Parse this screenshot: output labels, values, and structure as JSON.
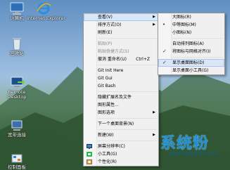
{
  "desktop_icons": [
    {
      "label": "计算机",
      "icon": "computer-icon"
    },
    {
      "label": "Internet Explorer",
      "icon": "ie-icon"
    },
    {
      "label": "回收站",
      "icon": "recycle-bin-icon"
    },
    {
      "label": "Remote Desktop",
      "icon": "remote-desktop-icon"
    },
    {
      "label": "宽带连接",
      "icon": "broadband-icon"
    },
    {
      "label": "控制面板",
      "icon": "control-panel-icon"
    }
  ],
  "context_menu": {
    "items": [
      {
        "label": "查看(V)",
        "submenu": true,
        "highlighted": true
      },
      {
        "label": "排序方式(O)",
        "submenu": true
      },
      {
        "label": "刷新(E)"
      },
      {
        "label": "粘贴(P)",
        "disabled": true
      },
      {
        "label": "粘贴快捷方式(S)",
        "disabled": true
      },
      {
        "label": "撤消 重命名(U)",
        "shortcut": "Ctrl+Z"
      },
      {
        "label": "Git Init Here"
      },
      {
        "label": "Git Gui"
      },
      {
        "label": "Git Bash"
      },
      {
        "label": "隐藏扩展名及文件"
      },
      {
        "label": "图形属性..."
      },
      {
        "label": "图形选项",
        "submenu": true
      },
      {
        "label": "下一个桌面背景(N)"
      },
      {
        "label": "新建(W)",
        "submenu": true
      },
      {
        "label": "屏幕分辨率(C)"
      },
      {
        "label": "小工具(G)"
      },
      {
        "label": "个性化(R)"
      }
    ]
  },
  "view_submenu": {
    "items": [
      {
        "label": "大图标(R)"
      },
      {
        "label": "中等图标(M)",
        "checked": true
      },
      {
        "label": "小图标(N)"
      },
      {
        "label": "自动排列图标(A)"
      },
      {
        "label": "将图标与网格对齐(I)",
        "checked": true
      },
      {
        "label": "显示桌面图标(D)",
        "checked": true,
        "highlighted": true
      },
      {
        "label": "显示桌面小工具(G)"
      }
    ]
  },
  "watermark": {
    "text": "系统粉",
    "url": "www.xitongfen.com"
  },
  "colors": {
    "menu_bg": "#f0f0f0",
    "highlight": "#d8e6f7",
    "disabled": "#8d8d8d",
    "watermark": "#1a8fd8"
  }
}
